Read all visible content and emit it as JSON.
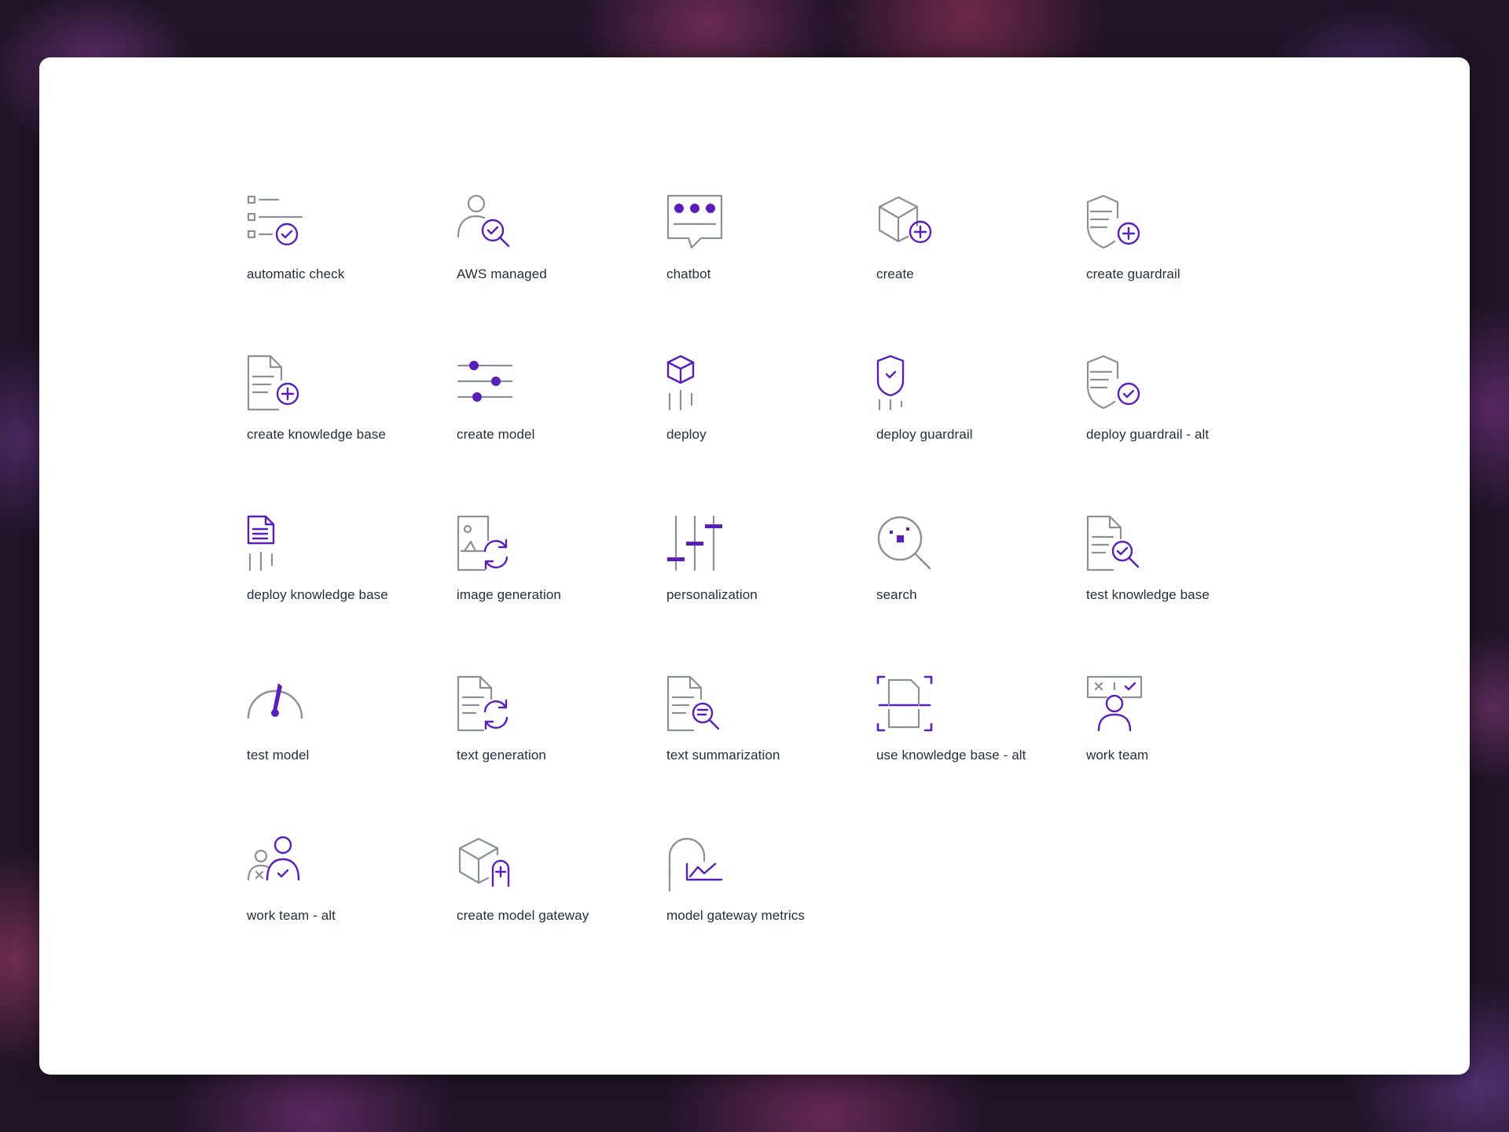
{
  "colors": {
    "accent": "#5a1fb8",
    "gray": "#8a8f98",
    "text": "#232f3e",
    "card": "#ffffff"
  },
  "icons": [
    {
      "label": "automatic check",
      "icon": "checklist-icon"
    },
    {
      "label": "AWS managed",
      "icon": "user-search-icon"
    },
    {
      "label": "chatbot",
      "icon": "chat-bubble-icon"
    },
    {
      "label": "create",
      "icon": "cube-plus-icon"
    },
    {
      "label": "create guardrail",
      "icon": "shield-plus-icon"
    },
    {
      "label": "create knowledge base",
      "icon": "document-plus-icon"
    },
    {
      "label": "create model",
      "icon": "sliders-icon"
    },
    {
      "label": "deploy",
      "icon": "cube-deploy-icon"
    },
    {
      "label": "deploy guardrail",
      "icon": "shield-deploy-icon"
    },
    {
      "label": "deploy guardrail - alt",
      "icon": "shield-check-icon"
    },
    {
      "label": "deploy knowledge base",
      "icon": "document-deploy-icon"
    },
    {
      "label": "image generation",
      "icon": "image-refresh-icon"
    },
    {
      "label": "personalization",
      "icon": "vertical-sliders-icon"
    },
    {
      "label": "search",
      "icon": "magnifier-icon"
    },
    {
      "label": "test knowledge base",
      "icon": "document-search-icon"
    },
    {
      "label": "test model",
      "icon": "gauge-icon"
    },
    {
      "label": "text generation",
      "icon": "document-refresh-icon"
    },
    {
      "label": "text summarization",
      "icon": "document-summary-icon"
    },
    {
      "label": "use knowledge base - alt",
      "icon": "document-scan-icon"
    },
    {
      "label": "work team",
      "icon": "user-board-icon"
    },
    {
      "label": "work team - alt",
      "icon": "team-icon"
    },
    {
      "label": "create model gateway",
      "icon": "cube-gateway-icon"
    },
    {
      "label": "model gateway metrics",
      "icon": "gateway-chart-icon"
    }
  ]
}
